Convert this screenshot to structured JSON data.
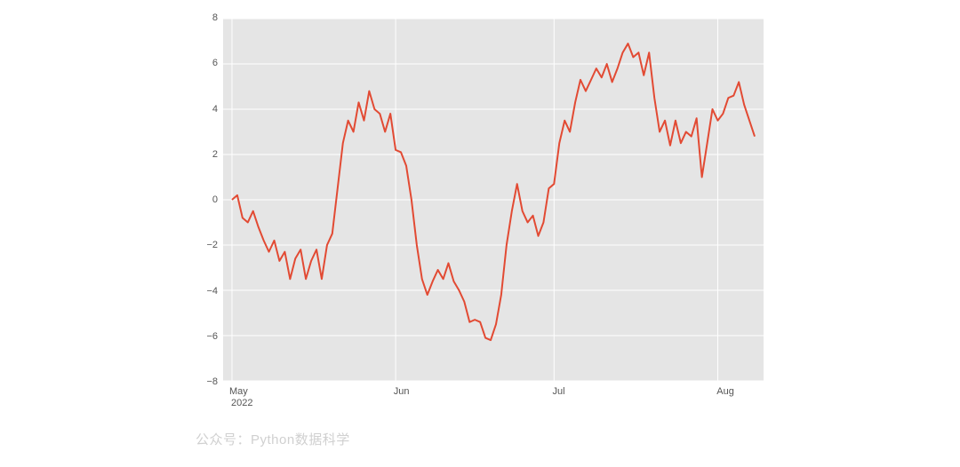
{
  "chart_data": {
    "type": "line",
    "title": "",
    "xlabel": "",
    "ylabel": "",
    "ylim": [
      -8,
      8
    ],
    "y_ticks": [
      -8,
      -6,
      -4,
      -2,
      0,
      2,
      4,
      6,
      8
    ],
    "x_ticks": [
      "May",
      "Jun",
      "Jul",
      "Aug"
    ],
    "x_sub_label": "2022",
    "x_year": "2022",
    "line_color": "#E24A33",
    "series": [
      {
        "name": "value",
        "x": [
          "2022-05-01",
          "2022-05-02",
          "2022-05-03",
          "2022-05-04",
          "2022-05-05",
          "2022-05-06",
          "2022-05-07",
          "2022-05-08",
          "2022-05-09",
          "2022-05-10",
          "2022-05-11",
          "2022-05-12",
          "2022-05-13",
          "2022-05-14",
          "2022-05-15",
          "2022-05-16",
          "2022-05-17",
          "2022-05-18",
          "2022-05-19",
          "2022-05-20",
          "2022-05-21",
          "2022-05-22",
          "2022-05-23",
          "2022-05-24",
          "2022-05-25",
          "2022-05-26",
          "2022-05-27",
          "2022-05-28",
          "2022-05-29",
          "2022-05-30",
          "2022-05-31",
          "2022-06-01",
          "2022-06-02",
          "2022-06-03",
          "2022-06-04",
          "2022-06-05",
          "2022-06-06",
          "2022-06-07",
          "2022-06-08",
          "2022-06-09",
          "2022-06-10",
          "2022-06-11",
          "2022-06-12",
          "2022-06-13",
          "2022-06-14",
          "2022-06-15",
          "2022-06-16",
          "2022-06-17",
          "2022-06-18",
          "2022-06-19",
          "2022-06-20",
          "2022-06-21",
          "2022-06-22",
          "2022-06-23",
          "2022-06-24",
          "2022-06-25",
          "2022-06-26",
          "2022-06-27",
          "2022-06-28",
          "2022-06-29",
          "2022-06-30",
          "2022-07-01",
          "2022-07-02",
          "2022-07-03",
          "2022-07-04",
          "2022-07-05",
          "2022-07-06",
          "2022-07-07",
          "2022-07-08",
          "2022-07-09",
          "2022-07-10",
          "2022-07-11",
          "2022-07-12",
          "2022-07-13",
          "2022-07-14",
          "2022-07-15",
          "2022-07-16",
          "2022-07-17",
          "2022-07-18",
          "2022-07-19",
          "2022-07-20",
          "2022-07-21",
          "2022-07-22",
          "2022-07-23",
          "2022-07-24",
          "2022-07-25",
          "2022-07-26",
          "2022-07-27",
          "2022-07-28",
          "2022-07-29",
          "2022-07-30",
          "2022-07-31",
          "2022-08-01",
          "2022-08-02",
          "2022-08-03",
          "2022-08-04",
          "2022-08-05",
          "2022-08-06",
          "2022-08-07",
          "2022-08-08"
        ],
        "values": [
          0.0,
          0.2,
          -0.8,
          -1.0,
          -0.5,
          -1.2,
          -1.8,
          -2.3,
          -1.8,
          -2.7,
          -2.3,
          -3.5,
          -2.6,
          -2.2,
          -3.5,
          -2.7,
          -2.2,
          -3.5,
          -2.0,
          -1.5,
          0.5,
          2.5,
          3.5,
          3.0,
          4.3,
          3.5,
          4.8,
          4.0,
          3.8,
          3.0,
          3.8,
          2.2,
          2.1,
          1.5,
          0.0,
          -2.0,
          -3.5,
          -4.2,
          -3.6,
          -3.1,
          -3.5,
          -2.8,
          -3.6,
          -4.0,
          -4.5,
          -5.4,
          -5.3,
          -5.4,
          -6.1,
          -6.2,
          -5.5,
          -4.2,
          -2.0,
          -0.5,
          0.7,
          -0.5,
          -1.0,
          -0.7,
          -1.6,
          -1.0,
          0.5,
          0.7,
          2.5,
          3.5,
          3.0,
          4.3,
          5.3,
          4.8,
          5.3,
          5.8,
          5.4,
          6.0,
          5.2,
          5.8,
          6.5,
          6.9,
          6.3,
          6.5,
          5.5,
          6.5,
          4.5,
          3.0,
          3.5,
          2.4,
          3.5,
          2.5,
          3.0,
          2.8,
          3.6,
          1.0,
          2.5,
          4.0,
          3.5,
          3.8,
          4.5,
          4.6,
          5.2,
          4.2,
          3.5,
          2.8
        ]
      }
    ]
  },
  "watermark": "公众号：Python数据科学"
}
